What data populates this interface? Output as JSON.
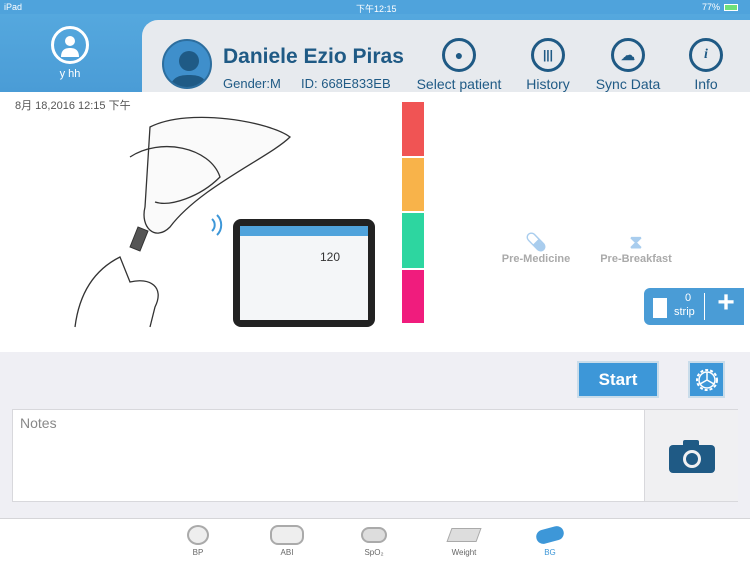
{
  "status": {
    "device": "iPad",
    "time": "下午12:15",
    "battery": "77%"
  },
  "user": {
    "name": "y hh"
  },
  "patient": {
    "name": "Daniele Ezio Piras",
    "gender": "Gender:M",
    "id": "ID: 668E833EB"
  },
  "header_buttons": [
    {
      "label": "Select patient",
      "icon": "person-icon"
    },
    {
      "label": "History",
      "icon": "bar-chart-icon"
    },
    {
      "label": "Sync Data",
      "icon": "cloud-download-icon"
    },
    {
      "label": "Info",
      "icon": "info-icon"
    }
  ],
  "datetime": "8月 18,2016 12:15 下午",
  "illustration": {
    "tablet_value": "120"
  },
  "range_colors": [
    "#f05454",
    "#f8b34a",
    "#2dd6a0",
    "#f01c7d"
  ],
  "meal_options": [
    {
      "label": "Pre-Medicine",
      "icon": "pill-icon"
    },
    {
      "label": "Pre-Breakfast",
      "icon": "apple-core-icon"
    }
  ],
  "strip": {
    "count": "0",
    "unit": "strip",
    "add": "+"
  },
  "start_label": "Start",
  "notes": {
    "placeholder": "Notes"
  },
  "tabs": [
    {
      "label": "BP",
      "active": false
    },
    {
      "label": "ABI",
      "active": false
    },
    {
      "label": "SpO₂",
      "active": false
    },
    {
      "label": "Weight",
      "active": false
    },
    {
      "label": "BG",
      "active": true
    }
  ],
  "accent": "#3d97d8"
}
